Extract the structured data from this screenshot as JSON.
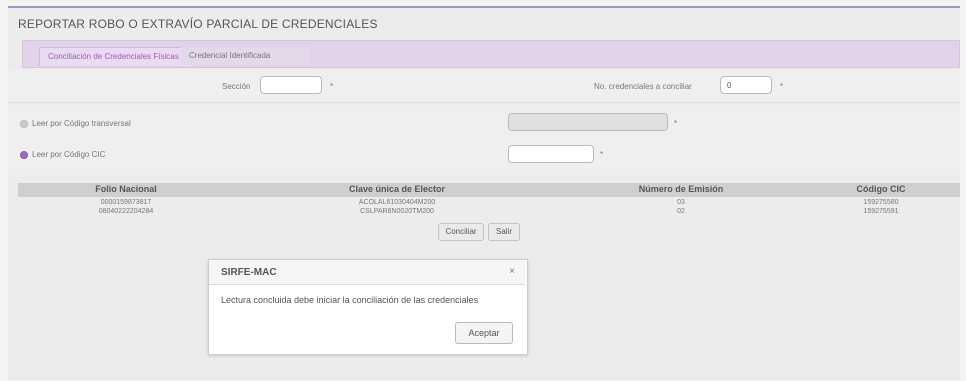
{
  "page": {
    "title": "REPORTAR ROBO O EXTRAVÍO PARCIAL DE CREDENCIALES",
    "tabs": [
      {
        "label": "Conciliación de Credenciales Físicas",
        "active": true
      },
      {
        "label": "Credencial Identificada",
        "active": false
      }
    ]
  },
  "form": {
    "seccion_label": "Sección",
    "seccion_value": "",
    "required_mark": "*",
    "credenciales_label": "No. credenciales a conciliar",
    "credenciales_value": "0",
    "radio_transversal_label": "Leer por Código transversal",
    "radio_cic_label": "Leer por Código CIC"
  },
  "table": {
    "headers": [
      "Folio Nacional",
      "Clave única de Elector",
      "Número de Emisión",
      "Código CIC"
    ],
    "rows": [
      [
        "0000159873817",
        "ACOLAL61030404M200",
        "03",
        "159275580"
      ],
      [
        "08040222204284",
        "CSLPAR6N0020TM200",
        "02",
        "159275591"
      ]
    ]
  },
  "actions": {
    "conciliar_label": "Conciliar",
    "salir_label": "Salir"
  },
  "dialog": {
    "title": "SIRFE-MAC",
    "close_icon": "×",
    "message": "Lectura concluida debe iniciar la conciliación de las credenciales",
    "accept_label": "Aceptar"
  }
}
